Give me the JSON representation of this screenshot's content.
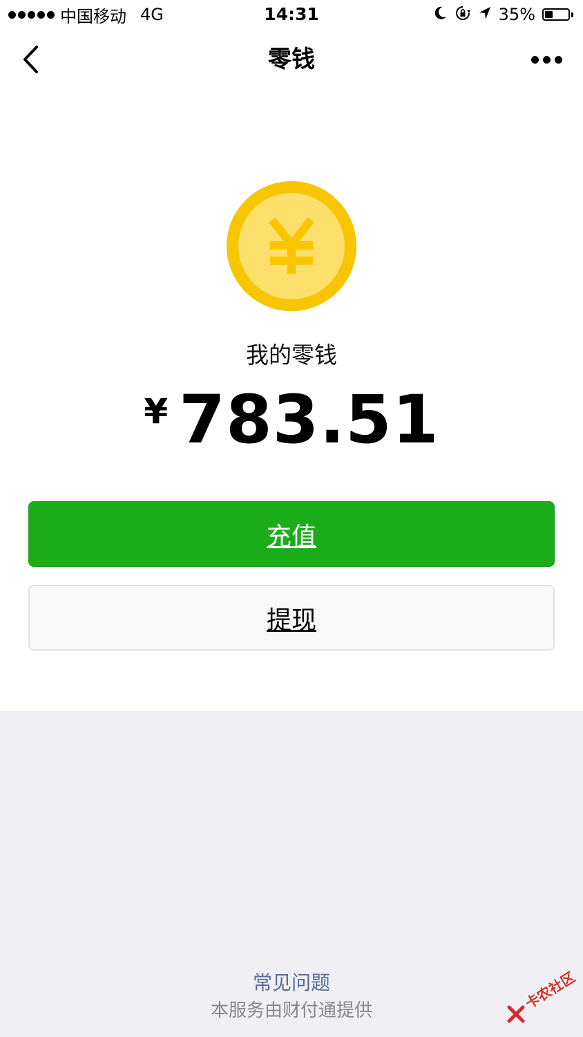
{
  "status_bar": {
    "carrier": "中国移动",
    "network": "4G",
    "time": "14:31",
    "battery_percent_text": "35%",
    "battery_level": 0.35,
    "icons": [
      "moon-icon",
      "rotation-lock-icon",
      "location-arrow-icon",
      "battery-icon"
    ]
  },
  "nav": {
    "title": "零钱",
    "back_icon": "chevron-left-icon",
    "more_icon": "more-dots-icon"
  },
  "wallet": {
    "coin_icon": "yuan-coin-icon",
    "label": "我的零钱",
    "currency_symbol": "¥",
    "amount": "783.51"
  },
  "actions": {
    "recharge_label": "充值",
    "withdraw_label": "提现"
  },
  "footer": {
    "faq_label": "常见问题",
    "provider_text": "本服务由财付通提供"
  },
  "watermark": {
    "text": "卡农社区"
  },
  "colors": {
    "primary_green": "#1aad19",
    "coin_outer": "#f7c600",
    "coin_inner": "#fde06b",
    "link_blue": "#576b95",
    "footer_bg": "#efeff4"
  }
}
